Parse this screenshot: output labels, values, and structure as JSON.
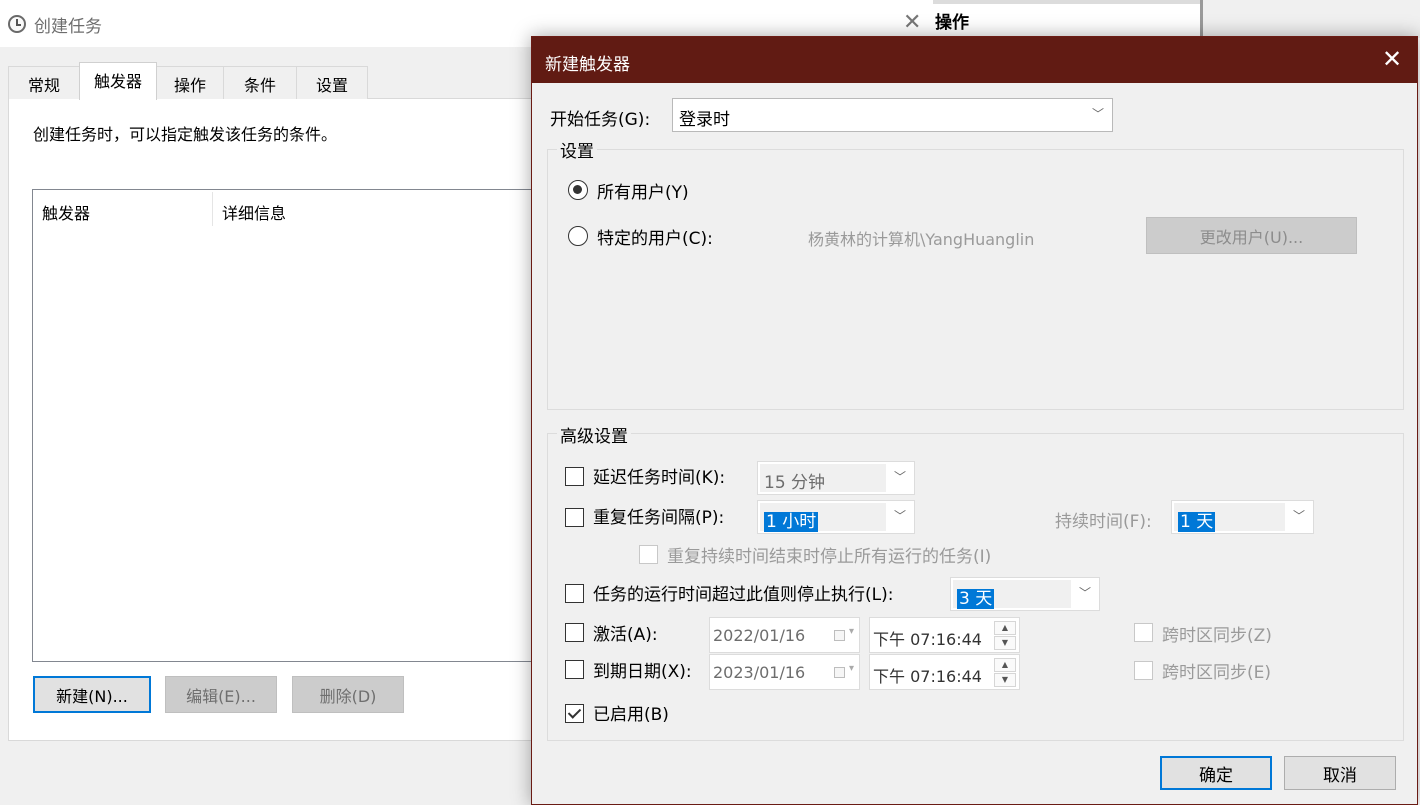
{
  "bg_window": {
    "title": "创建任务",
    "close": "✕",
    "right_pane_label": "操作",
    "tabs": [
      "常规",
      "触发器",
      "操作",
      "条件",
      "设置"
    ],
    "description": "创建任务时，可以指定触发该任务的条件。",
    "list_columns": [
      "触发器",
      "详细信息"
    ],
    "buttons": {
      "new": "新建(N)...",
      "edit": "编辑(E)...",
      "delete": "删除(D)"
    }
  },
  "dialog": {
    "title": "新建触发器",
    "close": "✕",
    "begin_task": {
      "label": "开始任务(G):",
      "value": "登录时"
    },
    "settings": {
      "title": "设置",
      "all_users": "所有用户(Y)",
      "specific_user": "特定的用户(C):",
      "user_name": "杨黄林的计算机\\YangHuanglin",
      "change_user": "更改用户(U)..."
    },
    "advanced": {
      "title": "高级设置",
      "delay_label": "延迟任务时间(K):",
      "delay_value": "15 分钟",
      "repeat_label": "重复任务间隔(P):",
      "repeat_value": "1 小时",
      "duration_label": "持续时间(F):",
      "duration_value": "1 天",
      "stop_all_label": "重复持续时间结束时停止所有运行的任务(I)",
      "stop_longer_label": "任务的运行时间超过此值则停止执行(L):",
      "stop_longer_value": "3 天",
      "activate_label": "激活(A):",
      "activate_date": "2022/01/16",
      "activate_time": "下午 07:16:44",
      "sync_tz_1": "跨时区同步(Z)",
      "expire_label": "到期日期(X):",
      "expire_date": "2023/01/16",
      "expire_time": "下午 07:16:44",
      "sync_tz_2": "跨时区同步(E)",
      "enabled_label": "已启用(B)"
    },
    "ok": "确定",
    "cancel": "取消"
  }
}
